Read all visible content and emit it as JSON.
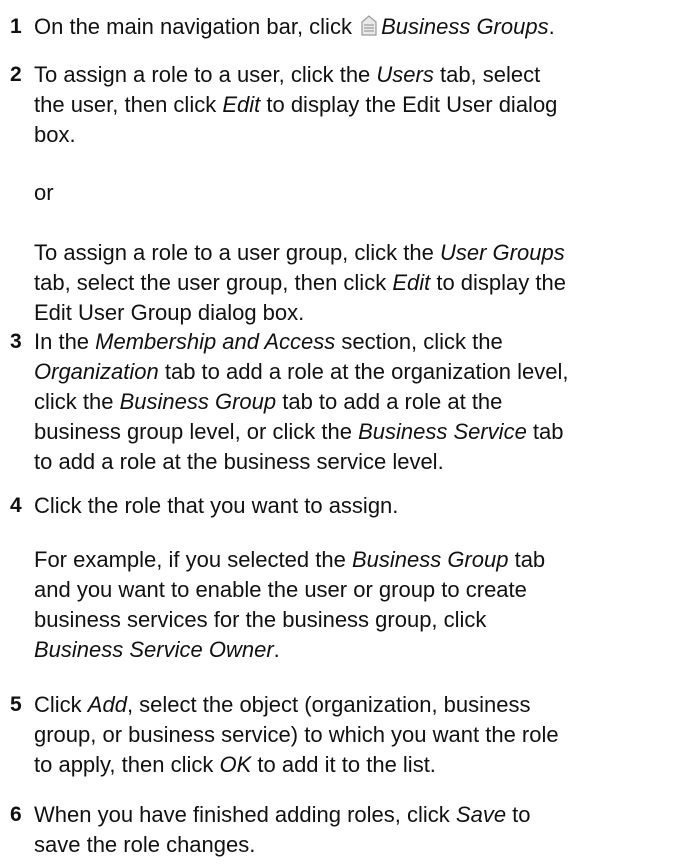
{
  "steps": [
    {
      "number": "1",
      "parts": [
        "On the main navigation bar, click ",
        "Business Groups",
        "."
      ],
      "icon": "business-groups-icon"
    },
    {
      "number": "2",
      "line1": [
        "To assign a role to a user, click the ",
        "Users",
        " tab, select"
      ],
      "line2": [
        "the user, then click ",
        "Edit",
        " to display the Edit User dialog"
      ],
      "line3": "box.",
      "or": "or",
      "alt_line1": [
        "To assign a role to a user group, click the ",
        "User Groups"
      ],
      "alt_line2": [
        "tab, select the user group, then click ",
        "Edit",
        " to display the"
      ],
      "alt_line3": "Edit User Group dialog box."
    },
    {
      "number": "3",
      "line1": [
        "In the ",
        "Membership and Access",
        " section, click the"
      ],
      "line2": [
        "Organization",
        " tab to add a role at the organization level,"
      ],
      "line3": [
        "click the ",
        "Business Group",
        " tab to add a role at the"
      ],
      "line4": [
        "business group level, or click the ",
        "Business Service",
        " tab"
      ],
      "line5": "to add a role at the business service level."
    },
    {
      "number": "4",
      "line1": "Click the role that you want to assign.",
      "ex_line1": [
        "For example, if you selected the ",
        "Business Group",
        " tab"
      ],
      "ex_line2": "and you want to enable the user or group to create",
      "ex_line3": "business services for the business group, click",
      "ex_line4": [
        "Business Service Owner",
        "."
      ]
    },
    {
      "number": "5",
      "line1": [
        "Click ",
        "Add",
        ", select the object (organization, business"
      ],
      "line2": "group, or business service) to which you want the role",
      "line3": [
        "to apply, then click ",
        "OK",
        " to add it to the list."
      ]
    },
    {
      "number": "6",
      "line1": [
        "When you have finished adding roles, click ",
        "Save",
        " to"
      ],
      "line2": "save the role changes."
    }
  ]
}
